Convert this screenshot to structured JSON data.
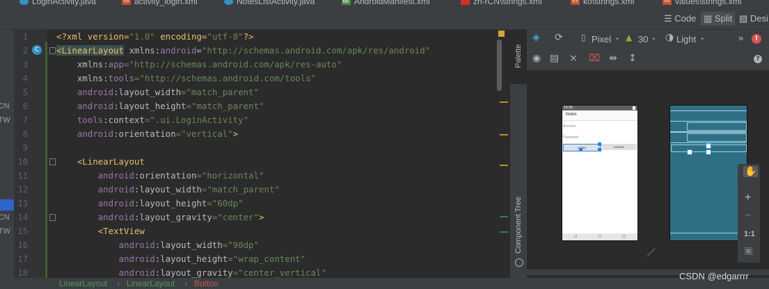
{
  "tabs": [
    {
      "label": "LoginActivity.java",
      "active": false,
      "icon": "java-class-icon"
    },
    {
      "label": "activity_login.xml",
      "active": true,
      "icon": "layout-xml-icon"
    },
    {
      "label": "NotesListActivity.java",
      "active": false,
      "icon": "java-class-icon"
    },
    {
      "label": "AndroidManifest.xml",
      "active": false,
      "icon": "manifest-icon"
    },
    {
      "label": "zh-rCN\\strings.xml",
      "active": false,
      "icon": "flag-icon"
    },
    {
      "label": "ko\\strings.xml",
      "active": false,
      "icon": "xml-icon"
    },
    {
      "label": "values\\strings.xml",
      "active": false,
      "icon": "xml-icon"
    }
  ],
  "view_modes": {
    "code": "Code",
    "split": "Split",
    "design": "Desi"
  },
  "left_strip": [
    "rCN",
    "rTW",
    "rCN",
    "rTW"
  ],
  "line_numbers": [
    "1",
    "2",
    "3",
    "4",
    "5",
    "6",
    "7",
    "8",
    "9",
    "10",
    "11",
    "12",
    "13",
    "14",
    "15",
    "16",
    "17",
    "18"
  ],
  "code": {
    "l1_a": "<?xml version=",
    "l1_b": "\"1.0\"",
    "l1_c": " encoding=",
    "l1_d": "\"utf-8\"",
    "l1_e": "?>",
    "l2_tag": "<LinearLayout",
    "l2_ns": " xmlns:",
    "l2_attr": "android",
    "l2_eq": "=",
    "l2_val": "\"http://schemas.android.com/apk/res/android\"",
    "l3_ns": "xmlns:",
    "l3_attr": "app",
    "l3_val": "=\"http://schemas.android.com/apk/res-auto\"",
    "l4_ns": "xmlns:",
    "l4_attr": "tools",
    "l4_val": "=\"http://schemas.android.com/tools\"",
    "l5_ns": "android",
    "l5_attr": ":layout_width",
    "l5_val": "=\"match_parent\"",
    "l6_ns": "android",
    "l6_attr": ":layout_height",
    "l6_val": "=\"match_parent\"",
    "l7_ns": "tools",
    "l7_attr": ":context",
    "l7_val": "=\".ui.LoginActivity\"",
    "l8_ns": "android",
    "l8_attr": ":orientation",
    "l8_val": "=\"vertical\"",
    "l8_end": ">",
    "l10_tag": "<LinearLayout",
    "l11_ns": "android",
    "l11_attr": ":orientation",
    "l11_val": "=\"horizontal\"",
    "l12_ns": "android",
    "l12_attr": ":layout_width",
    "l12_val": "=\"match_parent\"",
    "l13_ns": "android",
    "l13_attr": ":layout_height",
    "l13_val": "=\"60dp\"",
    "l14_ns": "android",
    "l14_attr": ":layout_gravity",
    "l14_val": "=\"center\"",
    "l14_end": ">",
    "l15_tag": "<TextView",
    "l16_ns": "android",
    "l16_attr": ":layout_width",
    "l16_val": "=\"90dp\"",
    "l17_ns": "android",
    "l17_attr": ":layout_height",
    "l17_val": "=\"wrap_content\"",
    "l18_ns": "android",
    "l18_attr": ":layout_gravity",
    "l18_val": "=\"center_vertical\""
  },
  "side_labels": {
    "palette": "Palette",
    "component_tree": "Component Tree"
  },
  "design_toolbar": {
    "device": "Pixel",
    "api": "30",
    "theme": "Light"
  },
  "preview": {
    "status_time": "10:28",
    "app_title": "Notes",
    "account_hint": "Account",
    "password_hint": "Password",
    "login_button": "LOGIN",
    "cancel_button": "CANCEL"
  },
  "zoom": {
    "zoom_in": "+",
    "zoom_out": "−",
    "actual_size": "1:1"
  },
  "breadcrumb": [
    "LinearLayout",
    "LinearLayout",
    "Button"
  ],
  "watermark": "CSDN @edgarrrr",
  "colors": {
    "accent": "#4a88c7",
    "tag": "#e8bf6a",
    "attr_ns": "#9876aa",
    "string": "#6a8759",
    "breadcrumb": "#4e9a5f",
    "breadcrumb_last": "#c75450"
  }
}
